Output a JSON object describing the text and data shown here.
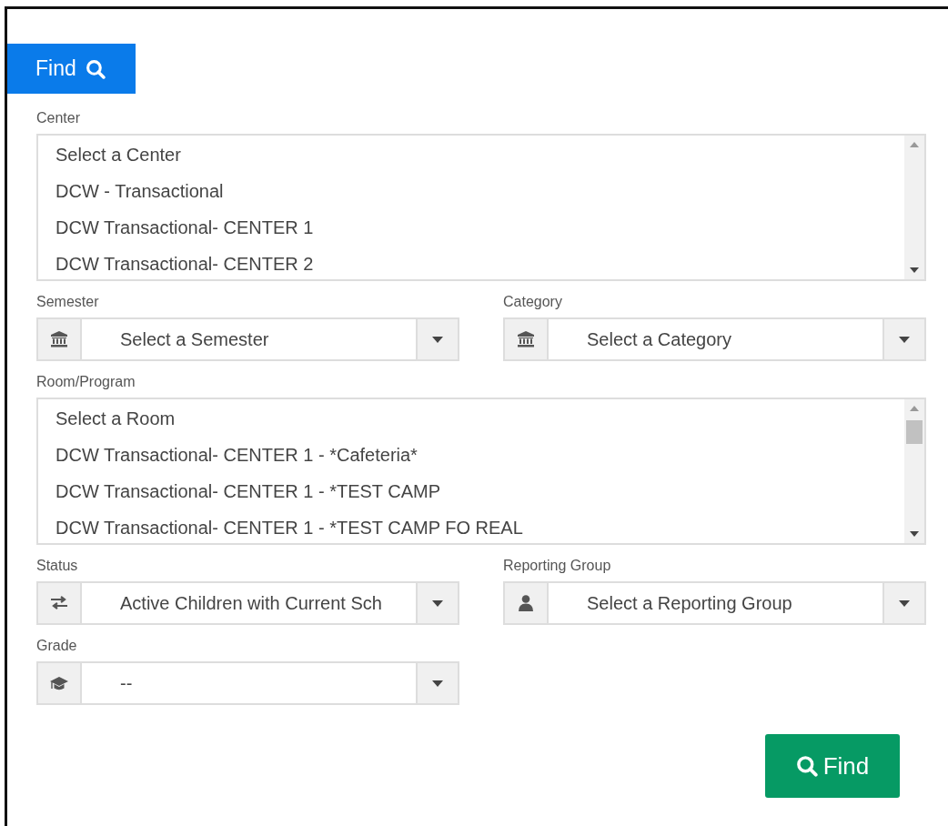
{
  "tab": {
    "label": "Find",
    "selected": true
  },
  "fields": [
    {
      "kind": "listbox",
      "label": "Center",
      "scroll_thumb": false,
      "options": [
        "Select a Center",
        "DCW - Transactional",
        "DCW Transactional- CENTER 1",
        "DCW Transactional- CENTER 2"
      ]
    },
    {
      "kind": "select",
      "label": "Semester",
      "value": "Select a Semester"
    },
    {
      "kind": "select",
      "label": "Category",
      "value": "Select a Category"
    },
    {
      "kind": "listbox",
      "label": "Room/Program",
      "scroll_thumb": true,
      "options": [
        "Select a Room",
        "DCW Transactional- CENTER 1 - *Cafeteria*",
        "DCW Transactional- CENTER 1 - *TEST CAMP",
        "DCW Transactional- CENTER 1 - *TEST CAMP FO REAL"
      ]
    },
    {
      "kind": "select",
      "label": "Status",
      "value": "Active Children with Current Sch"
    },
    {
      "kind": "select",
      "label": "Reporting Group",
      "value": "Select a Reporting Group"
    },
    {
      "kind": "select",
      "label": "Grade",
      "value": "--"
    }
  ],
  "find_button": {
    "label": "Find"
  }
}
